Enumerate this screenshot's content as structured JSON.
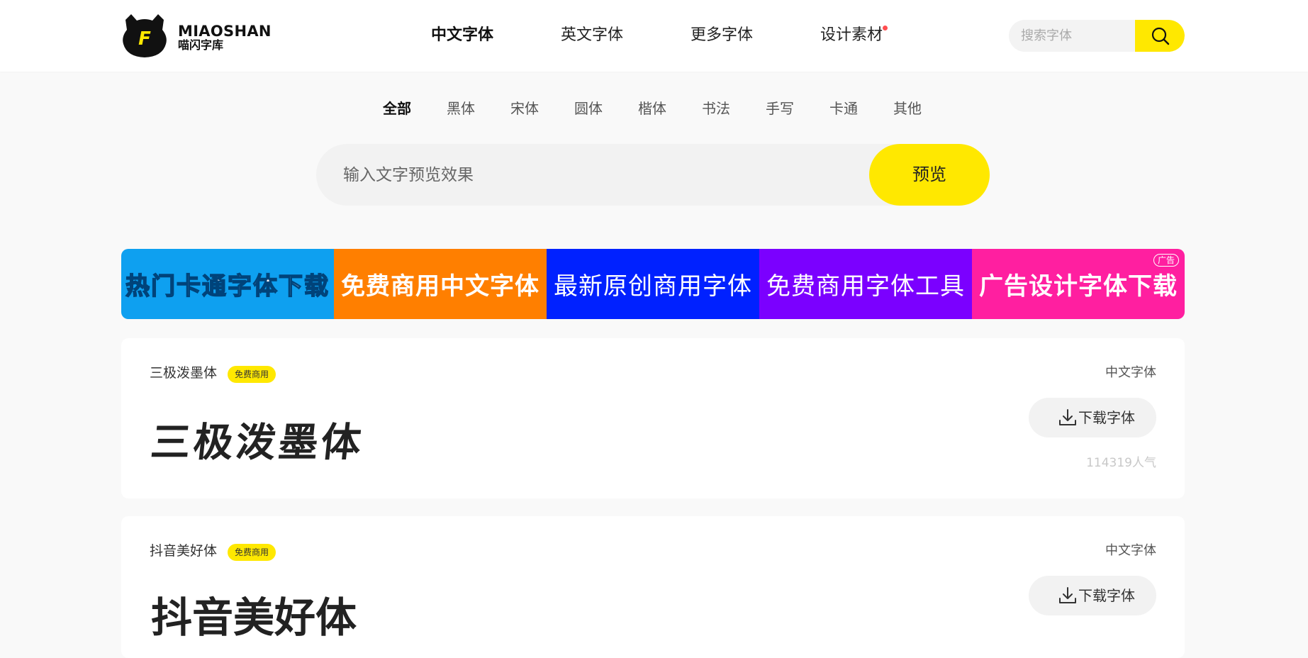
{
  "colors": {
    "accent": "#ffe800",
    "notify_dot": "#ff4d4f",
    "banner_1": "#0ea0f0",
    "banner_2": "#ff7f00",
    "banner_3": "#0021ff",
    "banner_4": "#7b00ff",
    "banner_5": "#ff1fa0"
  },
  "header": {
    "logo_letter": "F",
    "logo_title": "MIAOSHAN",
    "logo_subtitle": "喵闪字库",
    "nav": [
      {
        "label": "中文字体",
        "active": true
      },
      {
        "label": "英文字体",
        "active": false
      },
      {
        "label": "更多字体",
        "active": false
      },
      {
        "label": "设计素材",
        "active": false,
        "dot": true
      }
    ],
    "search": {
      "placeholder": "搜索字体",
      "icon": "search-icon"
    }
  },
  "categories": [
    {
      "label": "全部",
      "active": true
    },
    {
      "label": "黑体"
    },
    {
      "label": "宋体"
    },
    {
      "label": "圆体"
    },
    {
      "label": "楷体"
    },
    {
      "label": "书法"
    },
    {
      "label": "手写"
    },
    {
      "label": "卡通"
    },
    {
      "label": "其他"
    }
  ],
  "preview": {
    "placeholder": "输入文字预览效果",
    "button_label": "预览"
  },
  "banners": [
    {
      "text": "热门卡通字体下载"
    },
    {
      "text": "免费商用中文字体"
    },
    {
      "text": "最新原创商用字体"
    },
    {
      "text": "免费商用字体工具"
    },
    {
      "text": "广告设计字体下载",
      "badge": "广告"
    }
  ],
  "fonts": [
    {
      "name": "三极泼墨体",
      "tag": "免费商用",
      "type": "中文字体",
      "sample": "三极泼墨体",
      "download_label": "下载字体",
      "download_icon": "download-icon",
      "popularity": "114319人气"
    },
    {
      "name": "抖音美好体",
      "tag": "免费商用",
      "type": "中文字体",
      "sample": "抖音美好体",
      "download_label": "下载字体",
      "download_icon": "download-icon"
    }
  ]
}
